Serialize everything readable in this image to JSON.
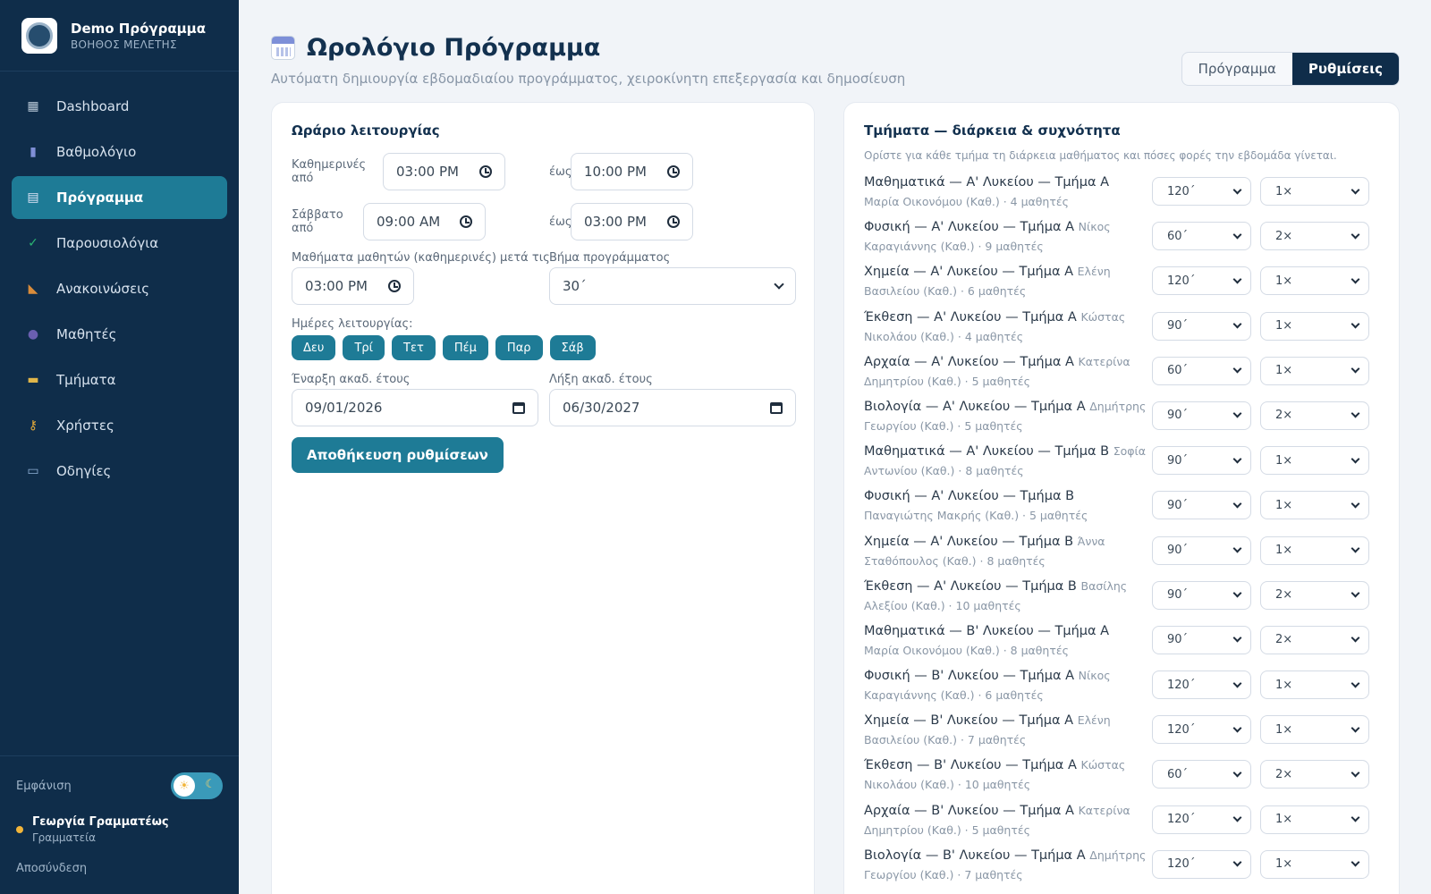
{
  "brand": {
    "title": "Demo Πρόγραμμα",
    "subtitle": "ΒΟΗΘΟΣ ΜΕΛΕΤΗΣ"
  },
  "nav": [
    {
      "label": "Dashboard",
      "icon": "grid-icon"
    },
    {
      "label": "Βαθμολόγιο",
      "icon": "bar-chart-icon"
    },
    {
      "label": "Πρόγραμμα",
      "icon": "calendar-icon",
      "active": true
    },
    {
      "label": "Παρουσιολόγια",
      "icon": "check-box-icon"
    },
    {
      "label": "Ανακοινώσεις",
      "icon": "megaphone-icon"
    },
    {
      "label": "Μαθητές",
      "icon": "people-icon"
    },
    {
      "label": "Τμήματα",
      "icon": "folder-icon"
    },
    {
      "label": "Χρήστες",
      "icon": "key-icon"
    },
    {
      "label": "Οδηγίες",
      "icon": "book-icon"
    }
  ],
  "sidebar_bottom": {
    "appearance_label": "Εμφάνιση",
    "user_name": "Γεωργία Γραμματέως",
    "user_role": "Γραμματεία",
    "logout": "Αποσύνδεση"
  },
  "header": {
    "title": "Ωρολόγιο Πρόγραμμα",
    "subtitle": "Αυτόματη δημιουργία εβδομαδιαίου προγράμματος, χειροκίνητη επεξεργασία και δημοσίευση",
    "tabs": [
      "Πρόγραμμα",
      "Ρυθμίσεις"
    ],
    "active_tab": "Ρυθμίσεις"
  },
  "settings": {
    "title": "Ωράριο λειτουργίας",
    "weekdays_from_label": "Καθημερινές από",
    "weekdays_from": "03:00 PM",
    "to_label": "έως",
    "weekdays_to": "10:00 PM",
    "saturday_from_label": "Σάββατο από",
    "saturday_from": "09:00 AM",
    "saturday_to": "03:00 PM",
    "student_after_label": "Μαθήματα μαθητών (καθημερινές) μετά τις",
    "student_after": "03:00 PM",
    "step_label": "Βήμα προγράμματος",
    "step": "30΄",
    "days_label": "Ημέρες λειτουργίας:",
    "days": [
      "Δευ",
      "Τρί",
      "Τετ",
      "Πέμ",
      "Παρ",
      "Σάβ"
    ],
    "year_start_label": "Έναρξη ακαδ. έτους",
    "year_start": "09/01/2026",
    "year_end_label": "Λήξη ακαδ. έτους",
    "year_end": "06/30/2027",
    "save_label": "Αποθήκευση ρυθμίσεων"
  },
  "departments": {
    "title": "Τμήματα — διάρκεια & συχνότητα",
    "description": "Ορίστε για κάθε τμήμα τη διάρκεια μαθήματος και πόσες φορές την εβδομάδα γίνεται.",
    "items": [
      {
        "name": "Μαθηματικά — Α' Λυκείου — Τμήμα Α",
        "meta": "Μαρία Οικονόμου (Καθ.) · 4 μαθητές",
        "duration": "120΄",
        "frequency": "1×"
      },
      {
        "name": "Φυσική — Α' Λυκείου — Τμήμα Α",
        "meta": "Νίκος Καραγιάννης (Καθ.) · 9 μαθητές",
        "duration": "60΄",
        "frequency": "2×"
      },
      {
        "name": "Χημεία — Α' Λυκείου — Τμήμα Α",
        "meta": "Ελένη Βασιλείου (Καθ.) · 6 μαθητές",
        "duration": "120΄",
        "frequency": "1×"
      },
      {
        "name": "Έκθεση — Α' Λυκείου — Τμήμα Α",
        "meta": "Κώστας Νικολάου (Καθ.) · 4 μαθητές",
        "duration": "90΄",
        "frequency": "1×"
      },
      {
        "name": "Αρχαία — Α' Λυκείου — Τμήμα Α",
        "meta": "Κατερίνα Δημητρίου (Καθ.) · 5 μαθητές",
        "duration": "60΄",
        "frequency": "1×"
      },
      {
        "name": "Βιολογία — Α' Λυκείου — Τμήμα Α",
        "meta": "Δημήτρης Γεωργίου (Καθ.) · 5 μαθητές",
        "duration": "90΄",
        "frequency": "2×"
      },
      {
        "name": "Μαθηματικά — Α' Λυκείου — Τμήμα Β",
        "meta": "Σοφία Αντωνίου (Καθ.) · 8 μαθητές",
        "duration": "90΄",
        "frequency": "1×"
      },
      {
        "name": "Φυσική — Α' Λυκείου — Τμήμα Β",
        "meta": "Παναγιώτης Μακρής (Καθ.) · 5 μαθητές",
        "duration": "90΄",
        "frequency": "1×"
      },
      {
        "name": "Χημεία — Α' Λυκείου — Τμήμα Β",
        "meta": "Άννα Σταθόπουλος (Καθ.) · 8 μαθητές",
        "duration": "90΄",
        "frequency": "1×"
      },
      {
        "name": "Έκθεση — Α' Λυκείου — Τμήμα Β",
        "meta": "Βασίλης Αλεξίου (Καθ.) · 10 μαθητές",
        "duration": "90΄",
        "frequency": "2×"
      },
      {
        "name": "Μαθηματικά — Β' Λυκείου — Τμήμα Α",
        "meta": "Μαρία Οικονόμου (Καθ.) · 8 μαθητές",
        "duration": "90΄",
        "frequency": "2×"
      },
      {
        "name": "Φυσική — Β' Λυκείου — Τμήμα Α",
        "meta": "Νίκος Καραγιάννης (Καθ.) · 6 μαθητές",
        "duration": "120΄",
        "frequency": "1×"
      },
      {
        "name": "Χημεία — Β' Λυκείου — Τμήμα Α",
        "meta": "Ελένη Βασιλείου (Καθ.) · 7 μαθητές",
        "duration": "120΄",
        "frequency": "1×"
      },
      {
        "name": "Έκθεση — Β' Λυκείου — Τμήμα Α",
        "meta": "Κώστας Νικολάου (Καθ.) · 10 μαθητές",
        "duration": "60΄",
        "frequency": "2×"
      },
      {
        "name": "Αρχαία — Β' Λυκείου — Τμήμα Α",
        "meta": "Κατερίνα Δημητρίου (Καθ.) · 5 μαθητές",
        "duration": "120΄",
        "frequency": "1×"
      },
      {
        "name": "Βιολογία — Β' Λυκείου — Τμήμα Α",
        "meta": "Δημήτρης Γεωργίου (Καθ.) · 7 μαθητές",
        "duration": "120΄",
        "frequency": "1×"
      }
    ]
  },
  "colors": {
    "sidebar": "#0f2d4a",
    "accent": "#1e7b96",
    "background": "#f1f4f8"
  }
}
